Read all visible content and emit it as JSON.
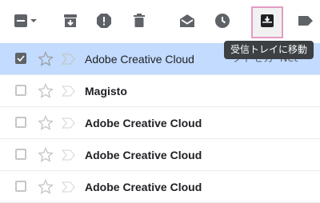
{
  "tooltip": {
    "text": "受信トレイに移動"
  },
  "toolbar": {
    "icons": [
      "select-all-checkbox-icon",
      "chevron-down-icon",
      "archive-icon",
      "report-spam-icon",
      "delete-icon",
      "mark-as-read-icon",
      "snooze-icon",
      "move-to-inbox-icon",
      "label-icon"
    ]
  },
  "messages": [
    {
      "sender": "Adobe Creative Cloud",
      "unread": false,
      "selected": true,
      "snippet": "クトセカ 'Net"
    },
    {
      "sender": "Magisto",
      "unread": true,
      "selected": false
    },
    {
      "sender": "Adobe Creative Cloud",
      "unread": true,
      "selected": false
    },
    {
      "sender": "Adobe Creative Cloud",
      "unread": true,
      "selected": false
    },
    {
      "sender": "Adobe Creative Cloud",
      "unread": true,
      "selected": false
    }
  ],
  "colors": {
    "selected_row": "#c2dbff",
    "highlight_border": "#e39cc4",
    "icon": "#5f6368"
  }
}
